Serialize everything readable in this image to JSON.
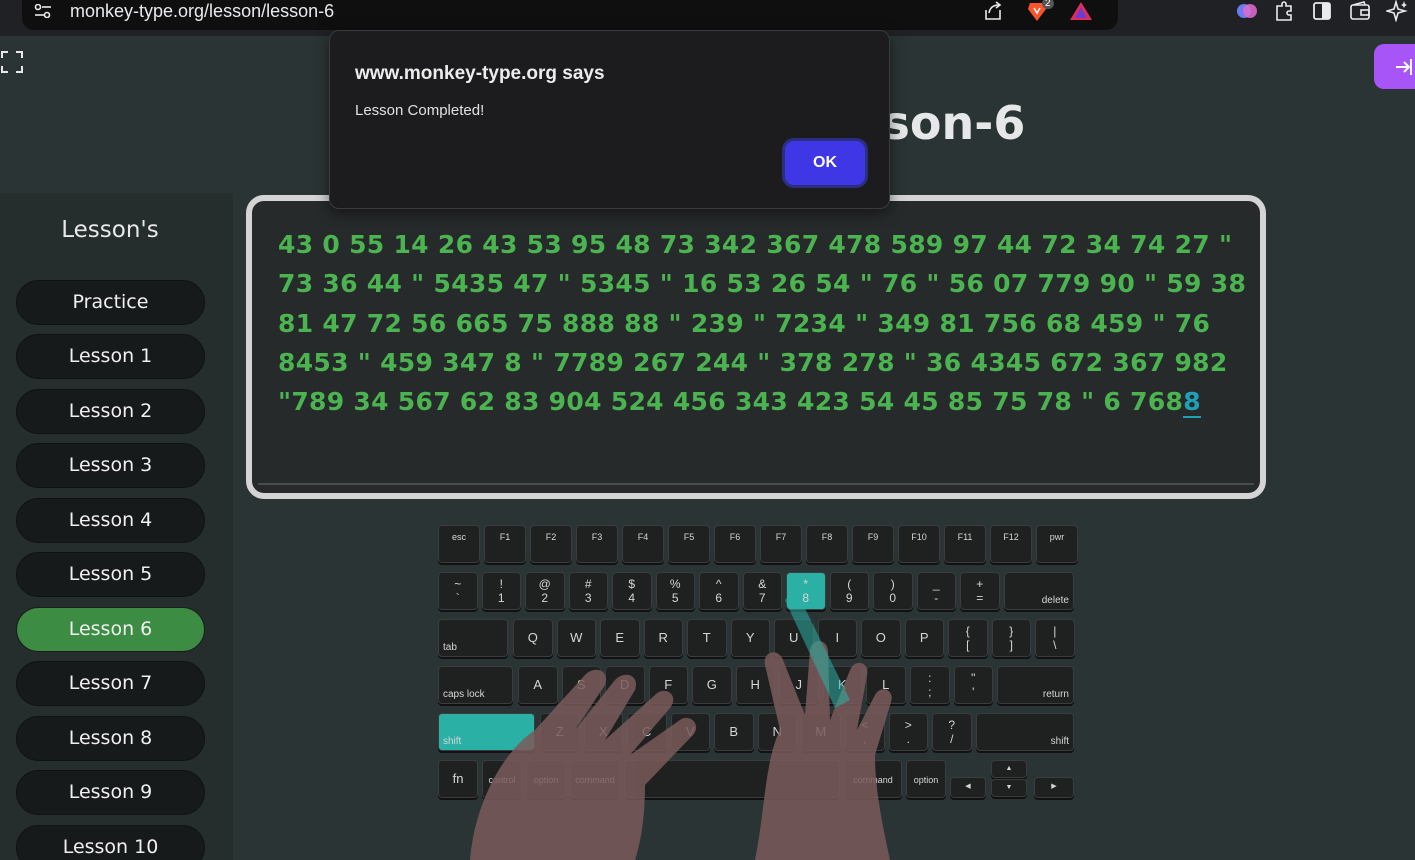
{
  "browser": {
    "url": "monkey-type.org/lesson/lesson-6",
    "brave_badge": "2",
    "icons": [
      "tune-icon",
      "share-icon",
      "brave-icon",
      "triangle-icon",
      "brain-extension-icon",
      "puzzle-extension-icon",
      "sidebar-icon",
      "wallet-icon",
      "leo-ai-icon"
    ]
  },
  "page": {
    "title": "Lesson-6",
    "sidebar_title": "Lesson's",
    "lessons": [
      "Practice",
      "Lesson 1",
      "Lesson 2",
      "Lesson 3",
      "Lesson 4",
      "Lesson 5",
      "Lesson 6",
      "Lesson 7",
      "Lesson 8",
      "Lesson 9",
      "Lesson 10"
    ],
    "active_lesson": "Lesson 6",
    "typed_text": "43 0 55 14 26 43 53 95 48 73 342 367 478 589 97 44 72 34 74 27 \" 73 36 44 \" 5435 47 \" 5345 \" 16 53 26 54 \" 76 \" 56 07 779 90 \" 59 38 81 47 72 56 665 75 888 88 \" 239 \" 7234 \" 349 81 756 68 459 \" 76 8453 \" 459 347 8 \" 7789 267 244 \" 378 278 \" 36 4345 672 367 982 \"789 34 567 62 83 904 524 456 343 423 54 45 85 75 78 \" 6 768",
    "cursor_char": "8",
    "colors": {
      "typed": "#4bb350",
      "cursor": "#1ea0b8",
      "active_lesson": "#3c8d43",
      "active_key": "#2bb0a6",
      "login_button": "#a855f7"
    }
  },
  "keyboard": {
    "fn_row": [
      "esc",
      "F1",
      "F2",
      "F3",
      "F4",
      "F5",
      "F6",
      "F7",
      "F8",
      "F9",
      "F10",
      "F11",
      "F12",
      "pwr"
    ],
    "num_row": [
      [
        "~",
        "`"
      ],
      [
        "!",
        "1"
      ],
      [
        "@",
        "2"
      ],
      [
        "#",
        "3"
      ],
      [
        "$",
        "4"
      ],
      [
        "%",
        "5"
      ],
      [
        "^",
        "6"
      ],
      [
        "&",
        "7"
      ],
      [
        "*",
        "8"
      ],
      [
        "(",
        "9"
      ],
      [
        ")",
        "0"
      ],
      [
        "_",
        "-"
      ],
      [
        "+",
        "="
      ]
    ],
    "delete": "delete",
    "tab": "tab",
    "top_row": [
      "Q",
      "W",
      "E",
      "R",
      "T",
      "Y",
      "U",
      "I",
      "O",
      "P"
    ],
    "top_row_sym": [
      [
        "{",
        "["
      ],
      [
        "}",
        "]"
      ],
      [
        "|",
        "\\"
      ]
    ],
    "caps": "caps lock",
    "home_row": [
      "A",
      "S",
      "D",
      "F",
      "G",
      "H",
      "J",
      "K",
      "L"
    ],
    "home_row_sym": [
      [
        ":",
        ";"
      ],
      [
        "\"",
        "'"
      ]
    ],
    "return": "return",
    "shift": "shift",
    "bottom_row": [
      "Z",
      "X",
      "C",
      "V",
      "B",
      "N",
      "M"
    ],
    "bottom_row_sym": [
      [
        "<",
        ","
      ],
      [
        ">",
        "."
      ],
      [
        "?",
        "/"
      ]
    ],
    "fn": "fn",
    "control": "control",
    "option": "option",
    "command": "command",
    "arrows": {
      "up": "▲",
      "down": "▼",
      "left": "◀",
      "right": "▶"
    },
    "active_keys": [
      "8",
      "shift-left"
    ]
  },
  "dialog": {
    "title": "www.monkey-type.org says",
    "message": "Lesson Completed!",
    "ok_label": "OK"
  }
}
